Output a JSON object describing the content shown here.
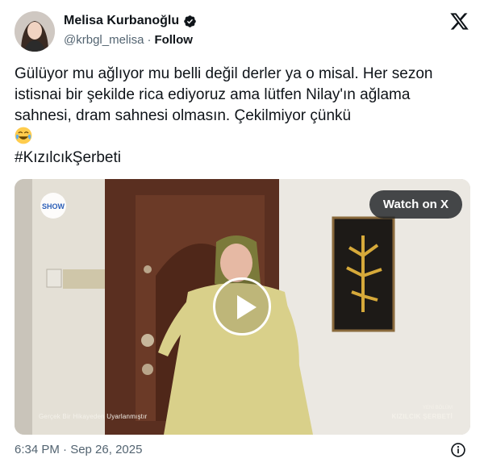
{
  "author": {
    "display_name": "Melisa Kurbanoğlu",
    "handle": "@krbgl_melisa",
    "separator": "·",
    "follow_label": "Follow"
  },
  "tweet": {
    "text": "Gülüyor mu ağlıyor mu belli değil derler ya o misal. Her sezon istisnai bir şekilde rica ediyoruz ama lütfen Nilay'ın ağlama sahnesi, dram sahnesi olmasın. Çekilmiyor çünkü",
    "emoji": "joy-emoji",
    "hashtag": "#KızılcıkŞerbeti"
  },
  "video": {
    "watch_label": "Watch on X",
    "caption_left": "Gerçek Bir Hikayeden Uyarlanmıştır",
    "caption_right_small": "YENİ BÖLÜM",
    "caption_right_title": "KIZILCIK ŞERBETİ",
    "channel_logo_text": "SHOW"
  },
  "footer": {
    "timestamp": "6:34 PM · Sep 26, 2025"
  },
  "colors": {
    "text": "#0f1419",
    "secondary": "#536471",
    "verified": "#1d9bf0"
  },
  "icons": {
    "brand": "x-logo-icon",
    "verified": "verified-badge-icon",
    "info": "info-icon",
    "play": "play-icon"
  }
}
